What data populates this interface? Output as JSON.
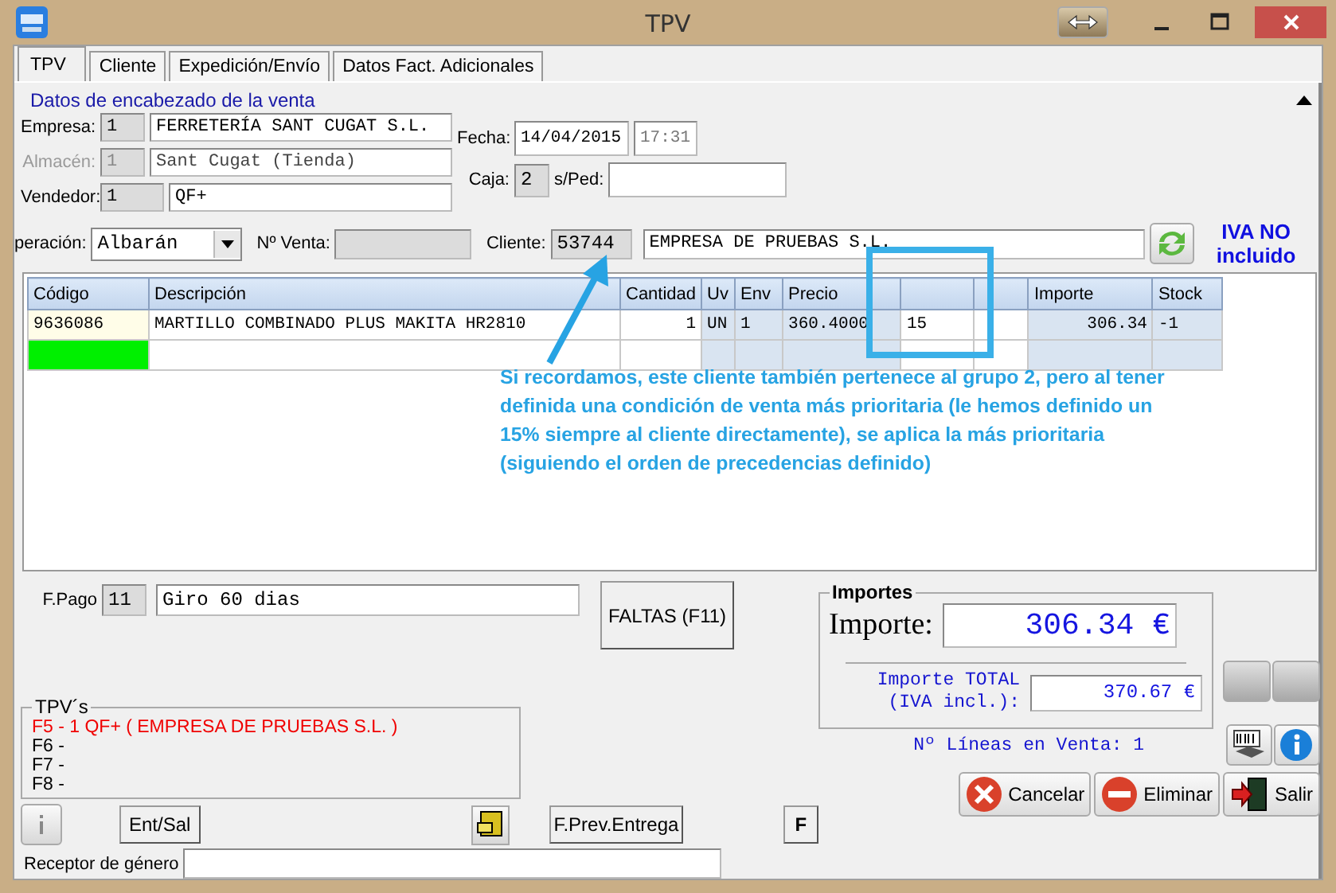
{
  "window": {
    "title": "TPV"
  },
  "tabs": [
    {
      "label": "TPV",
      "selected": true
    },
    {
      "label": "Cliente",
      "selected": false
    },
    {
      "label": "Expedición/Envío",
      "selected": false
    },
    {
      "label": "Datos Fact. Adicionales",
      "selected": false
    }
  ],
  "header": {
    "section_title": "Datos de encabezado de la venta",
    "empresa": {
      "label": "Empresa:",
      "code": "1",
      "name": "FERRETERÍA SANT CUGAT S.L.",
      "disabled": false
    },
    "almacen": {
      "label": "Almacén:",
      "code": "1",
      "name": "Sant Cugat (Tienda)",
      "disabled": true
    },
    "vendedor": {
      "label": "Vendedor:",
      "code": "1",
      "name": "QF+",
      "disabled": false
    },
    "fecha": {
      "label": "Fecha:",
      "date": "14/04/2015",
      "time": "17:31"
    },
    "caja": {
      "label": "Caja:",
      "value": "2"
    },
    "pedido": {
      "label": "s/Ped:"
    },
    "operacion": {
      "label": "peración:",
      "value": "Albarán"
    },
    "num_venta": {
      "label": "Nº Venta:"
    },
    "cliente": {
      "label": "Cliente:",
      "code": "53744",
      "name": "EMPRESA DE PRUEBAS S.L."
    },
    "iva_note": "IVA NO incluido"
  },
  "table": {
    "columns": [
      {
        "label": "Código"
      },
      {
        "label": "Descripción"
      },
      {
        "label": "Cantidad"
      },
      {
        "label": "Uv"
      },
      {
        "label": "Env"
      },
      {
        "label": "Precio"
      },
      {},
      {},
      {
        "label": "Importe"
      },
      {
        "label": "Stock"
      }
    ],
    "rows": [
      {
        "cells": [
          "9636086",
          "MARTILLO COMBINADO PLUS MAKITA HR2810",
          "1",
          "UN",
          "1",
          "360.4000",
          "15",
          null,
          "306.34",
          "-1"
        ],
        "selected": false
      },
      {
        "cells": [
          null,
          null,
          null,
          null,
          null,
          null,
          null,
          null,
          null,
          null
        ],
        "selected": true
      }
    ]
  },
  "annotation": "Si recordamos, este cliente también pertenece al grupo 2, pero al tener definida una condición de venta más prioritaria (le hemos definido un 15% siempre al cliente directamente), se aplica la más prioritaria (siguiendo el orden de precedencias definido)",
  "pago": {
    "label": "F.Pago",
    "code": "11",
    "name": "Giro 60 dias"
  },
  "faltas_button": "FALTAS (F11)",
  "tpvs": {
    "title": "TPV´s",
    "items": [
      {
        "label": "F5 - 1 QF+ ( EMPRESA DE PRUEBAS S.L. )",
        "selected": true
      },
      {
        "label": "F6 -",
        "selected": false
      },
      {
        "label": "F7 -",
        "selected": false
      },
      {
        "label": "F8 -",
        "selected": false
      }
    ]
  },
  "importes": {
    "title": "Importes",
    "importe_label": "Importe:",
    "importe": "306.34 €",
    "total_label": "Importe TOTAL (IVA incl.):",
    "total": "370.67 €"
  },
  "lines_count": "Nº Líneas en Venta: 1",
  "left_buttons": [
    "Ent/Sal",
    "F.Prev.Entrega",
    "F"
  ],
  "action_buttons": [
    {
      "kind": "cancel",
      "label": "Cancelar"
    },
    {
      "kind": "delete",
      "label": "Eliminar"
    },
    {
      "kind": "exit",
      "label": "Salir"
    }
  ],
  "receptor": {
    "label": "Receptor de género"
  }
}
